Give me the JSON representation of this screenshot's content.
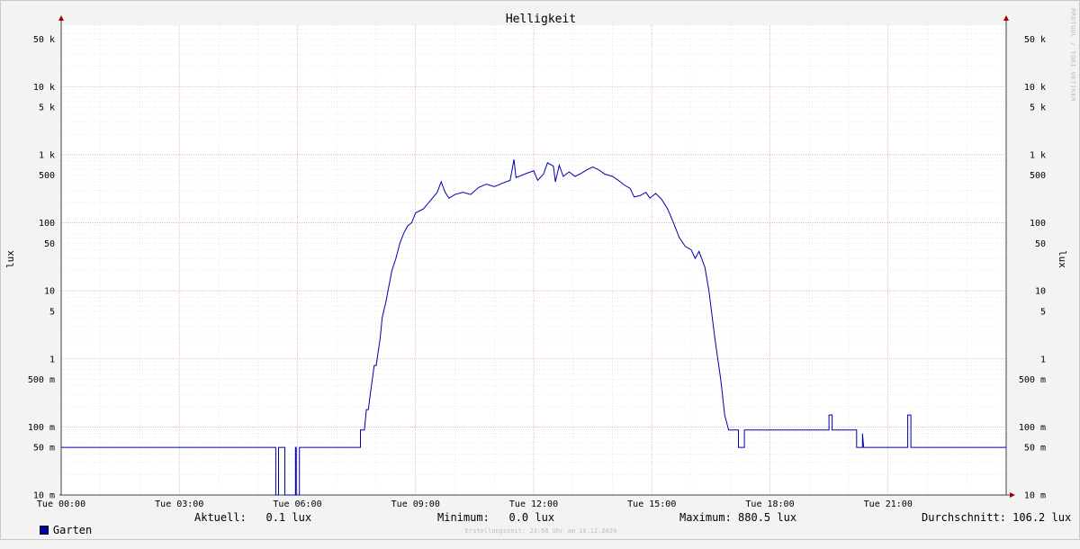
{
  "chart_data": {
    "type": "line",
    "title": "Helligkeit",
    "ylabel": "lux",
    "yscale": "log",
    "ylim": [
      0.01,
      80000
    ],
    "xlim": [
      "00:00",
      "24:00"
    ],
    "grid": true,
    "x_ticks": [
      {
        "t": 0,
        "label": "Tue 00:00"
      },
      {
        "t": 3,
        "label": "Tue 03:00"
      },
      {
        "t": 6,
        "label": "Tue 06:00"
      },
      {
        "t": 9,
        "label": "Tue 09:00"
      },
      {
        "t": 12,
        "label": "Tue 12:00"
      },
      {
        "t": 15,
        "label": "Tue 15:00"
      },
      {
        "t": 18,
        "label": "Tue 18:00"
      },
      {
        "t": 21,
        "label": "Tue 21:00"
      }
    ],
    "y_ticks": [
      {
        "v": 0.01,
        "label": "10 m"
      },
      {
        "v": 0.05,
        "label": "50 m"
      },
      {
        "v": 0.1,
        "label": "100 m"
      },
      {
        "v": 0.5,
        "label": "500 m"
      },
      {
        "v": 1,
        "label": "1"
      },
      {
        "v": 5,
        "label": "5"
      },
      {
        "v": 10,
        "label": "10"
      },
      {
        "v": 50,
        "label": "50"
      },
      {
        "v": 100,
        "label": "100"
      },
      {
        "v": 500,
        "label": "500"
      },
      {
        "v": 1000,
        "label": "1 k"
      },
      {
        "v": 5000,
        "label": "5 k"
      },
      {
        "v": 10000,
        "label": "10 k"
      },
      {
        "v": 50000,
        "label": "50 k"
      }
    ],
    "series": [
      {
        "name": "Garten",
        "color": "#0000aa",
        "points": [
          [
            0,
            0.05
          ],
          [
            5.45,
            0.05
          ],
          [
            5.45,
            0.01
          ],
          [
            5.52,
            0.01
          ],
          [
            5.52,
            0.05
          ],
          [
            5.68,
            0.05
          ],
          [
            5.68,
            0.01
          ],
          [
            5.95,
            0.01
          ],
          [
            5.95,
            0.05
          ],
          [
            5.97,
            0.05
          ],
          [
            5.97,
            0.01
          ],
          [
            6.05,
            0.01
          ],
          [
            6.05,
            0.05
          ],
          [
            7.6,
            0.05
          ],
          [
            7.6,
            0.09
          ],
          [
            7.7,
            0.09
          ],
          [
            7.75,
            0.18
          ],
          [
            7.8,
            0.18
          ],
          [
            7.85,
            0.3
          ],
          [
            7.95,
            0.8
          ],
          [
            8.0,
            0.8
          ],
          [
            8.1,
            2.0
          ],
          [
            8.15,
            4.0
          ],
          [
            8.25,
            7.0
          ],
          [
            8.3,
            10.0
          ],
          [
            8.4,
            20.0
          ],
          [
            8.5,
            30.0
          ],
          [
            8.6,
            50.0
          ],
          [
            8.7,
            70.0
          ],
          [
            8.8,
            90.0
          ],
          [
            8.9,
            100.0
          ],
          [
            9.0,
            140.0
          ],
          [
            9.2,
            160.0
          ],
          [
            9.4,
            220.0
          ],
          [
            9.55,
            280.0
          ],
          [
            9.65,
            400.0
          ],
          [
            9.75,
            280.0
          ],
          [
            9.85,
            230.0
          ],
          [
            10.0,
            260.0
          ],
          [
            10.2,
            280.0
          ],
          [
            10.4,
            260.0
          ],
          [
            10.6,
            330.0
          ],
          [
            10.8,
            370.0
          ],
          [
            11.0,
            340.0
          ],
          [
            11.2,
            380.0
          ],
          [
            11.4,
            420.0
          ],
          [
            11.5,
            850.0
          ],
          [
            11.55,
            460.0
          ],
          [
            11.7,
            500.0
          ],
          [
            11.85,
            540.0
          ],
          [
            12.0,
            580.0
          ],
          [
            12.1,
            420.0
          ],
          [
            12.25,
            520.0
          ],
          [
            12.35,
            760.0
          ],
          [
            12.5,
            680.0
          ],
          [
            12.55,
            400.0
          ],
          [
            12.65,
            700.0
          ],
          [
            12.75,
            480.0
          ],
          [
            12.9,
            560.0
          ],
          [
            13.05,
            480.0
          ],
          [
            13.2,
            530.0
          ],
          [
            13.35,
            600.0
          ],
          [
            13.5,
            660.0
          ],
          [
            13.65,
            600.0
          ],
          [
            13.8,
            520.0
          ],
          [
            14.0,
            480.0
          ],
          [
            14.15,
            420.0
          ],
          [
            14.3,
            360.0
          ],
          [
            14.45,
            320.0
          ],
          [
            14.55,
            240.0
          ],
          [
            14.7,
            250.0
          ],
          [
            14.85,
            280.0
          ],
          [
            14.95,
            230.0
          ],
          [
            15.1,
            270.0
          ],
          [
            15.25,
            220.0
          ],
          [
            15.4,
            160.0
          ],
          [
            15.55,
            100.0
          ],
          [
            15.7,
            60.0
          ],
          [
            15.85,
            45.0
          ],
          [
            16.0,
            40.0
          ],
          [
            16.1,
            30.0
          ],
          [
            16.2,
            38.0
          ],
          [
            16.35,
            22.0
          ],
          [
            16.45,
            10.0
          ],
          [
            16.6,
            2.0
          ],
          [
            16.75,
            0.5
          ],
          [
            16.85,
            0.15
          ],
          [
            16.95,
            0.09
          ],
          [
            17.2,
            0.09
          ],
          [
            17.2,
            0.05
          ],
          [
            17.35,
            0.05
          ],
          [
            17.35,
            0.09
          ],
          [
            19.5,
            0.09
          ],
          [
            19.5,
            0.15
          ],
          [
            19.58,
            0.15
          ],
          [
            19.58,
            0.09
          ],
          [
            20.2,
            0.09
          ],
          [
            20.2,
            0.05
          ],
          [
            20.35,
            0.05
          ],
          [
            20.35,
            0.08
          ],
          [
            20.38,
            0.05
          ],
          [
            21.5,
            0.05
          ],
          [
            21.5,
            0.15
          ],
          [
            21.58,
            0.15
          ],
          [
            21.58,
            0.05
          ],
          [
            24.0,
            0.05
          ]
        ]
      }
    ]
  },
  "credit": "RRDTOOL / TOBI OETIKER",
  "legend": {
    "series_name": "Garten",
    "series_color": "#0000aa",
    "aktuell": "Aktuell:   0.1 lux",
    "minimum": "Minimum:   0.0 lux",
    "maximum": "Maximum: 880.5 lux",
    "durchschnitt": "Durchschnitt: 106.2 lux"
  },
  "footer": "Erstellungszeit: 23:58 Uhr am 10.12.2024"
}
